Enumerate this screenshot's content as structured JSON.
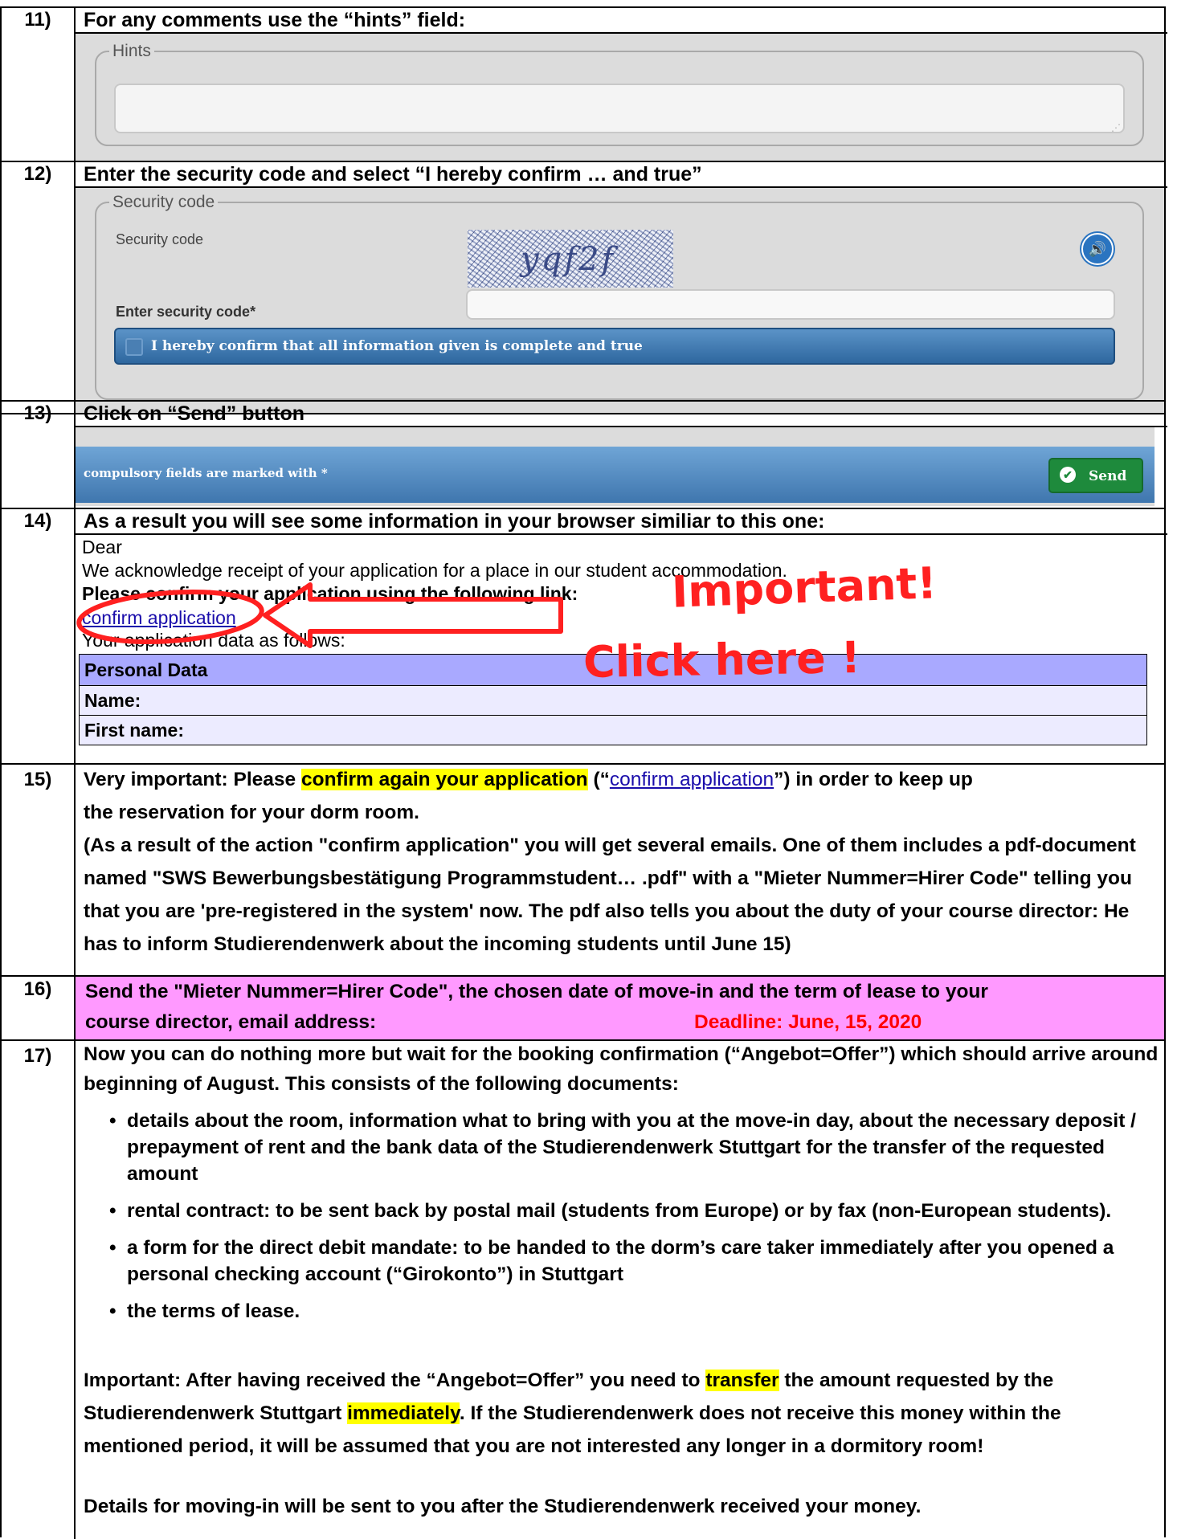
{
  "rows": {
    "r11": {
      "num": "11)",
      "title": "For any comments use the “hints” field:"
    },
    "r12": {
      "num": "12)",
      "title": "Enter the security code and select “I hereby confirm … and true”"
    },
    "r13": {
      "num": "13)",
      "title": "Click on “Send” button"
    },
    "r14": {
      "num": "14)",
      "title": "As a result you will see some information in your browser similiar to this one:"
    },
    "r15": {
      "num": "15)",
      "line1_pre": "Very important: Please ",
      "line1_hl": "confirm again your application",
      "line1_mid": " (“",
      "line1_link": "confirm application",
      "line1_post": "”) in order to keep up",
      "line2": "the reservation for your dorm room.",
      "para2": "(As a result of the action \"confirm application\" you will get several emails. One of them includes a pdf-document named \"SWS Bewerbungsbestätigung Programmstudent… .pdf\" with a \"Mieter Nummer=Hirer Code\" telling you that you are 'pre-registered in the system' now. The pdf also tells you about the duty of your course director: He has to inform Studierendenwerk about the incoming students until June 15)"
    },
    "r16": {
      "num": "16)",
      "line1": "Send the \"Mieter Nummer=Hirer Code\", the chosen date of move-in and the term of lease to your",
      "line2": "course director, email address:",
      "deadline": "Deadline: June, 15, 2020"
    },
    "r17": {
      "num": "17)",
      "intro": "Now you can do nothing more but wait for the booking confirmation (“Angebot=Offer”) which should arrive around beginning of August. This consists of the following documents:",
      "bullets": [
        "details about the room, information what to bring with you at the move-in day, about the necessary deposit / prepayment of rent and the bank data of the Studierendenwerk Stuttgart for the transfer of the requested amount",
        "rental contract: to be sent back by postal mail (students from Europe) or by fax (non-European students).",
        "a form for the direct debit mandate: to be handed to the dorm’s care taker immediately after you opened a personal checking account (“Girokonto”) in Stuttgart",
        "the terms of lease."
      ],
      "imp_pre": "Important: After having received the “Angebot=Offer” you need to ",
      "imp_hl1": "transfer",
      "imp_mid": " the amount requested by the Studierendenwerk Stuttgart ",
      "imp_hl2": "immediately",
      "imp_post": ". If the Studierendenwerk does not receive this money within the mentioned period, it will be assumed that you are not interested any longer in a dormitory room!",
      "details": "Details for moving-in will be sent to you after the Studierendenwerk received your money."
    }
  },
  "hints_form": {
    "legend": "Hints"
  },
  "security_form": {
    "legend": "Security code",
    "code_label": "Security code",
    "captcha_text": "yqf2f",
    "enter_label": "Enter security code*",
    "confirm_label": "I hereby confirm that all information given is complete and true"
  },
  "send_bar": {
    "note": "compulsory fields are marked with *",
    "button": "Send"
  },
  "browser_result": {
    "dear": "Dear",
    "ack": "We acknowledge receipt of your application for a place in our student accommodation.",
    "please": "Please confirm your application using the following link:",
    "link": "confirm application",
    "data_follows": "Your application data as follows:",
    "table": {
      "header": "Personal Data",
      "rows": [
        "Name:",
        "First name:"
      ]
    },
    "annotation1": "Important!",
    "annotation2": "Click here !"
  },
  "colors": {
    "highlight": "#ffff00",
    "row16_bg": "#ff99ff",
    "deadline": "#ff0000",
    "annotation": "#ff2020",
    "table_header": "#a9a9ff",
    "table_row": "#ecebff",
    "send_button": "#1e8a3c"
  }
}
